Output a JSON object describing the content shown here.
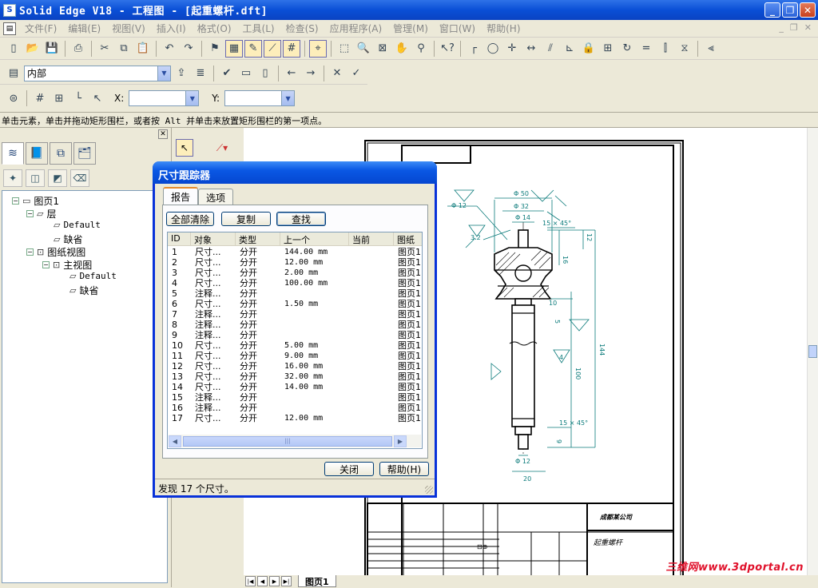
{
  "window": {
    "title": "Solid Edge V18 - 工程图 - [起重螺杆.dft]",
    "app_icon": "solid-edge-icon"
  },
  "menu": {
    "items": [
      "文件(F)",
      "编辑(E)",
      "视图(V)",
      "插入(I)",
      "格式(O)",
      "工具(L)",
      "检查(S)",
      "应用程序(A)",
      "管理(M)",
      "窗口(W)",
      "帮助(H)"
    ]
  },
  "toolbar2": {
    "layer_combo": "内部",
    "x_label": "X:",
    "y_label": "Y:",
    "x_value": "",
    "y_value": ""
  },
  "prompt": "单击元素，单击并拖动矩形围栏，或者按 Alt 并单击来放置矩形围栏的第一项点。",
  "tree": {
    "root": "图页1",
    "layers": "层",
    "layer_default": "Default",
    "layer_missing": "缺省",
    "drawing_views": "图纸视图",
    "main_view": "主视图",
    "view_default": "Default",
    "view_missing": "缺省"
  },
  "dialog": {
    "title": "尺寸跟踪器",
    "tabs": [
      "报告",
      "选项"
    ],
    "clear_all": "全部清除",
    "copy": "复制",
    "find": "查找",
    "columns": [
      "ID",
      "对象",
      "类型",
      "上一个",
      "当前",
      "图纸"
    ],
    "rows": [
      {
        "id": "1",
        "object": "尺寸...",
        "type": "分开",
        "prev": "144.00 mm",
        "cur": "",
        "sheet": "图页1"
      },
      {
        "id": "2",
        "object": "尺寸...",
        "type": "分开",
        "prev": "12.00 mm",
        "cur": "",
        "sheet": "图页1"
      },
      {
        "id": "3",
        "object": "尺寸...",
        "type": "分开",
        "prev": "2.00 mm",
        "cur": "",
        "sheet": "图页1"
      },
      {
        "id": "4",
        "object": "尺寸...",
        "type": "分开",
        "prev": "100.00 mm",
        "cur": "",
        "sheet": "图页1"
      },
      {
        "id": "5",
        "object": "注释...",
        "type": "分开",
        "prev": "",
        "cur": "",
        "sheet": "图页1"
      },
      {
        "id": "6",
        "object": "尺寸...",
        "type": "分开",
        "prev": "1.50 mm",
        "cur": "",
        "sheet": "图页1"
      },
      {
        "id": "7",
        "object": "注释...",
        "type": "分开",
        "prev": "",
        "cur": "",
        "sheet": "图页1"
      },
      {
        "id": "8",
        "object": "注释...",
        "type": "分开",
        "prev": "",
        "cur": "",
        "sheet": "图页1"
      },
      {
        "id": "9",
        "object": "注释...",
        "type": "分开",
        "prev": "",
        "cur": "",
        "sheet": "图页1"
      },
      {
        "id": "10",
        "object": "尺寸...",
        "type": "分开",
        "prev": "5.00 mm",
        "cur": "",
        "sheet": "图页1"
      },
      {
        "id": "11",
        "object": "尺寸...",
        "type": "分开",
        "prev": "9.00 mm",
        "cur": "",
        "sheet": "图页1"
      },
      {
        "id": "12",
        "object": "尺寸...",
        "type": "分开",
        "prev": "16.00 mm",
        "cur": "",
        "sheet": "图页1"
      },
      {
        "id": "13",
        "object": "尺寸...",
        "type": "分开",
        "prev": "32.00 mm",
        "cur": "",
        "sheet": "图页1"
      },
      {
        "id": "14",
        "object": "尺寸...",
        "type": "分开",
        "prev": "14.00 mm",
        "cur": "",
        "sheet": "图页1"
      },
      {
        "id": "15",
        "object": "注释...",
        "type": "分开",
        "prev": "",
        "cur": "",
        "sheet": "图页1"
      },
      {
        "id": "16",
        "object": "注释...",
        "type": "分开",
        "prev": "",
        "cur": "",
        "sheet": "图页1"
      },
      {
        "id": "17",
        "object": "尺寸...",
        "type": "分开",
        "prev": "12.00 mm",
        "cur": "",
        "sheet": "图页1"
      }
    ],
    "close": "关闭",
    "help": "帮助(H)",
    "status": "发现 17 个尺寸。"
  },
  "drawing": {
    "dims": {
      "d50": "Φ 50",
      "d32": "Φ 32",
      "d14": "Φ 14",
      "d12t": "Φ 12",
      "d12b": "Φ 12",
      "d20": "20",
      "c15": "15 × 45°",
      "c15b": "15 × 45°",
      "l144": "144",
      "l100": "100",
      "l16": "16",
      "l12": "12",
      "l10": "10",
      "l5": "5",
      "l9": "9",
      "mark4": "4",
      "mark32": "3.2"
    },
    "titleblock": {
      "company": "成都某公司",
      "part_name": "起重螺杆"
    }
  },
  "sheet_tab": "图页1",
  "watermark": "三维网www.3dportal.cn"
}
